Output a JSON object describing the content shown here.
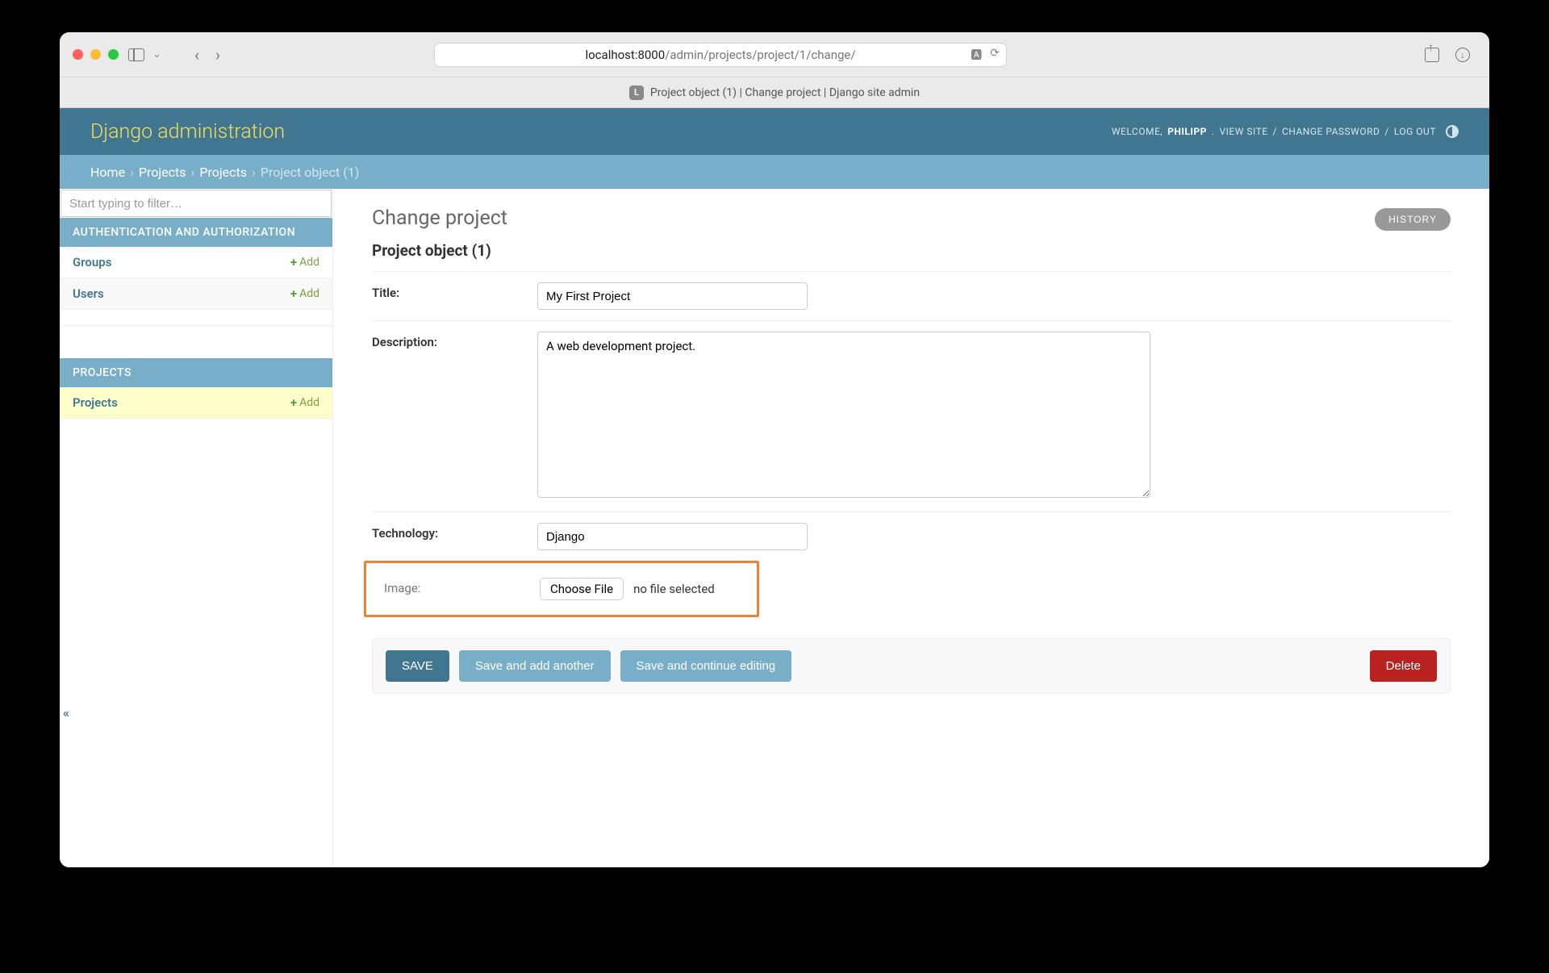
{
  "browser": {
    "url_host": "localhost:8000",
    "url_path": "/admin/projects/project/1/change/",
    "tab_title": "Project object (1) | Change project | Django site admin",
    "favicon_letter": "L"
  },
  "header": {
    "site_title": "Django administration",
    "welcome": "WELCOME, ",
    "username": "PHILIPP",
    "view_site": "VIEW SITE",
    "change_password": "CHANGE PASSWORD",
    "log_out": "LOG OUT"
  },
  "breadcrumbs": {
    "home": "Home",
    "projects_app": "Projects",
    "projects_model": "Projects",
    "current": "Project object (1)",
    "sep": "›"
  },
  "sidebar": {
    "filter_placeholder": "Start typing to filter…",
    "sections": [
      {
        "title": "AUTHENTICATION AND AUTHORIZATION",
        "rows": [
          {
            "label": "Groups",
            "add": "Add"
          },
          {
            "label": "Users",
            "add": "Add"
          }
        ]
      },
      {
        "title": "PROJECTS",
        "rows": [
          {
            "label": "Projects",
            "add": "Add"
          }
        ]
      }
    ]
  },
  "collapse_handle": "«",
  "content": {
    "heading": "Change project",
    "object_title": "Project object (1)",
    "history_button": "HISTORY",
    "form": {
      "title_label": "Title:",
      "title_value": "My First Project",
      "description_label": "Description:",
      "description_value": "A web development project.",
      "technology_label": "Technology:",
      "technology_value": "Django",
      "image_label": "Image:",
      "choose_file": "Choose File",
      "no_file": "no file selected"
    },
    "buttons": {
      "save": "SAVE",
      "save_add": "Save and add another",
      "save_continue": "Save and continue editing",
      "delete": "Delete"
    }
  }
}
